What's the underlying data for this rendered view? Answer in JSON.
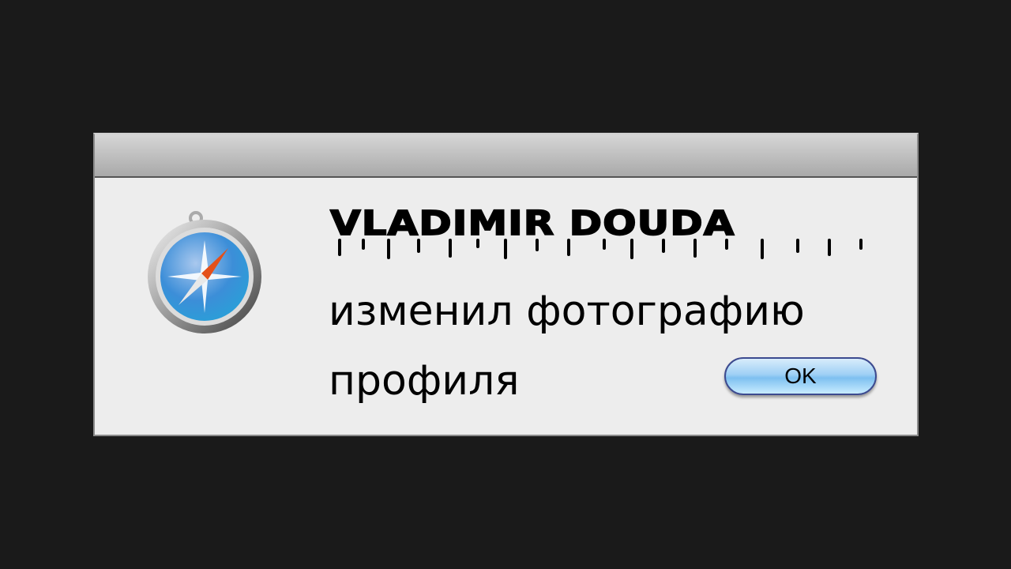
{
  "dialog": {
    "title": "",
    "app_icon": "safari-compass-icon",
    "sender_name": "VLADIMIR DOUDA",
    "message": "изменил фотографию профиля",
    "ok_label": "OK"
  },
  "colors": {
    "background": "#1a1a1a",
    "dialog": "#ededed",
    "button": "#9fd0f5"
  }
}
